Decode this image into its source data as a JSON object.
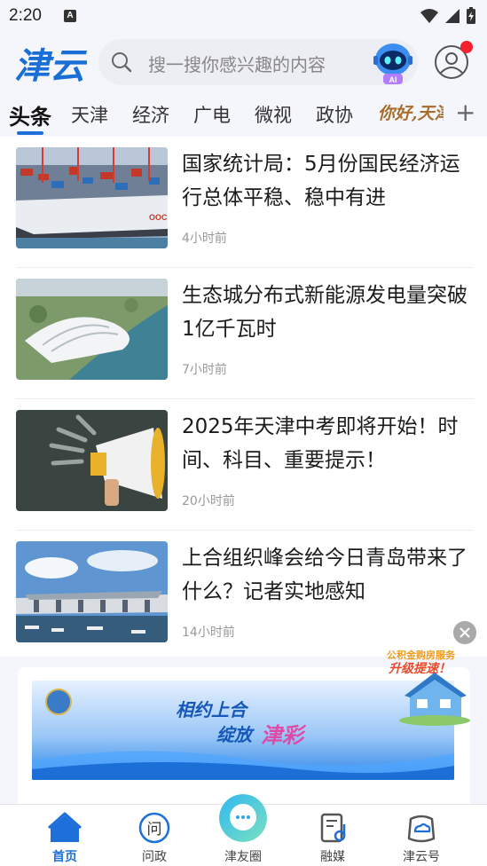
{
  "status_bar": {
    "time": "2:20",
    "indicator": "A"
  },
  "header": {
    "logo_text": "津云",
    "search_placeholder": "搜一搜你感兴趣的内容",
    "ai_badge": "AI"
  },
  "tabs": {
    "items": [
      "头条",
      "天津",
      "经济",
      "广电",
      "微视",
      "政协"
    ],
    "active": "头条",
    "special_tab": "你好,天津",
    "add_icon": "plus-icon"
  },
  "news": [
    {
      "title": "国家统计局：5月份国民经济运行总体平稳、稳中有进",
      "time": "4小时前",
      "thumb": "container-port-ship"
    },
    {
      "title": "生态城分布式新能源发电量突破1亿千瓦时",
      "time": "7小时前",
      "thumb": "aerial-white-building"
    },
    {
      "title": "2025年天津中考即将开始！时间、科目、重要提示！",
      "time": "20小时前",
      "thumb": "megaphone"
    },
    {
      "title": "上合组织峰会给今日青岛带来了什么？记者实地感知",
      "time": "14小时前",
      "thumb": "convention-center"
    }
  ],
  "ad": {
    "headline_1": "相约上合",
    "headline_2": "绽放",
    "headline_accent": "津彩",
    "promo_1": "公积金购房服务",
    "promo_2": "升级提速！"
  },
  "bottom_nav": {
    "items": [
      {
        "label": "首页",
        "icon": "home-icon",
        "active": true
      },
      {
        "label": "问政",
        "icon": "ask-icon",
        "active": false
      },
      {
        "label": "津友圈",
        "icon": "chat-bubble-icon",
        "active": false
      },
      {
        "label": "融媒",
        "icon": "media-icon",
        "active": false
      },
      {
        "label": "津云号",
        "icon": "cloud-account-icon",
        "active": false
      }
    ]
  },
  "colors": {
    "accent": "#1e6fd9",
    "background": "#f4f6fb",
    "notification": "#f5222d",
    "logo": "#1a6fd6"
  }
}
